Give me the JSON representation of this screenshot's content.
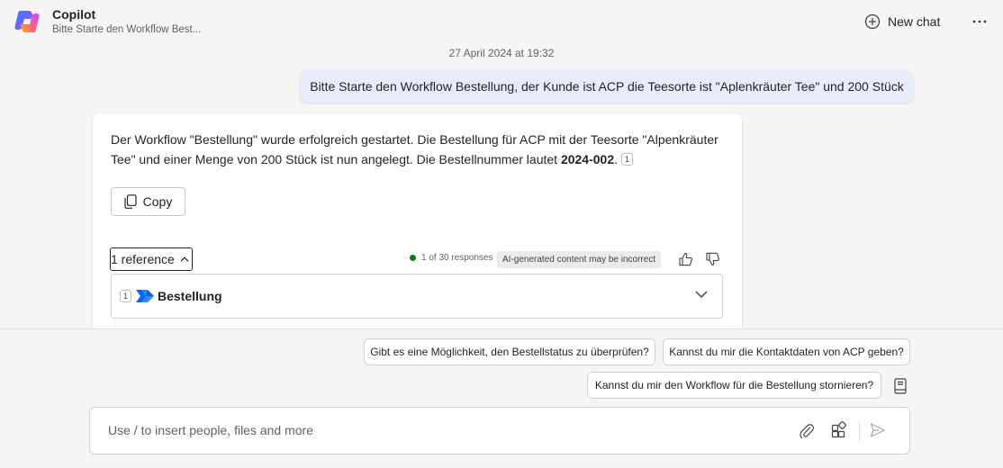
{
  "header": {
    "title": "Copilot",
    "subtitle": "Bitte Starte den Workflow Best...",
    "new_chat_label": "New chat"
  },
  "conversation": {
    "timestamp": "27 April 2024 at 19:32",
    "user_message": "Bitte Starte den Workflow Bestellung, der Kunde ist ACP die Teesorte ist \"Aplenkräuter Tee\" und 200 Stück",
    "bot_message": {
      "text_part1": "Der Workflow \"Bestellung\" wurde erfolgreich gestartet. Die Bestellung für ACP mit der Teesorte \"Alpenkräuter Tee\" und einer Menge von 200 Stück ist nun angelegt. Die Bestellnummer lautet ",
      "order_number": "2024-002",
      "text_part2": ".",
      "citation": "1",
      "copy_label": "Copy",
      "references_label": "1 reference",
      "response_count": "1 of 30 responses",
      "ai_disclaimer": "AI-generated content may be incorrect",
      "reference": {
        "number": "1",
        "name": "Bestellung",
        "icon": "power-automate-icon"
      }
    }
  },
  "suggestions": [
    "Gibt es eine Möglichkeit, den Bestellstatus zu überprüfen?",
    "Kannst du mir die Kontaktdaten von ACP geben?",
    "Kannst du mir den Workflow für die Bestellung stornieren?"
  ],
  "composer": {
    "placeholder": "Use / to insert people, files and more",
    "value": ""
  },
  "colors": {
    "accent": "#5b5fc7",
    "user_bubble": "#e8ebfa",
    "status_dot": "#107c10"
  }
}
